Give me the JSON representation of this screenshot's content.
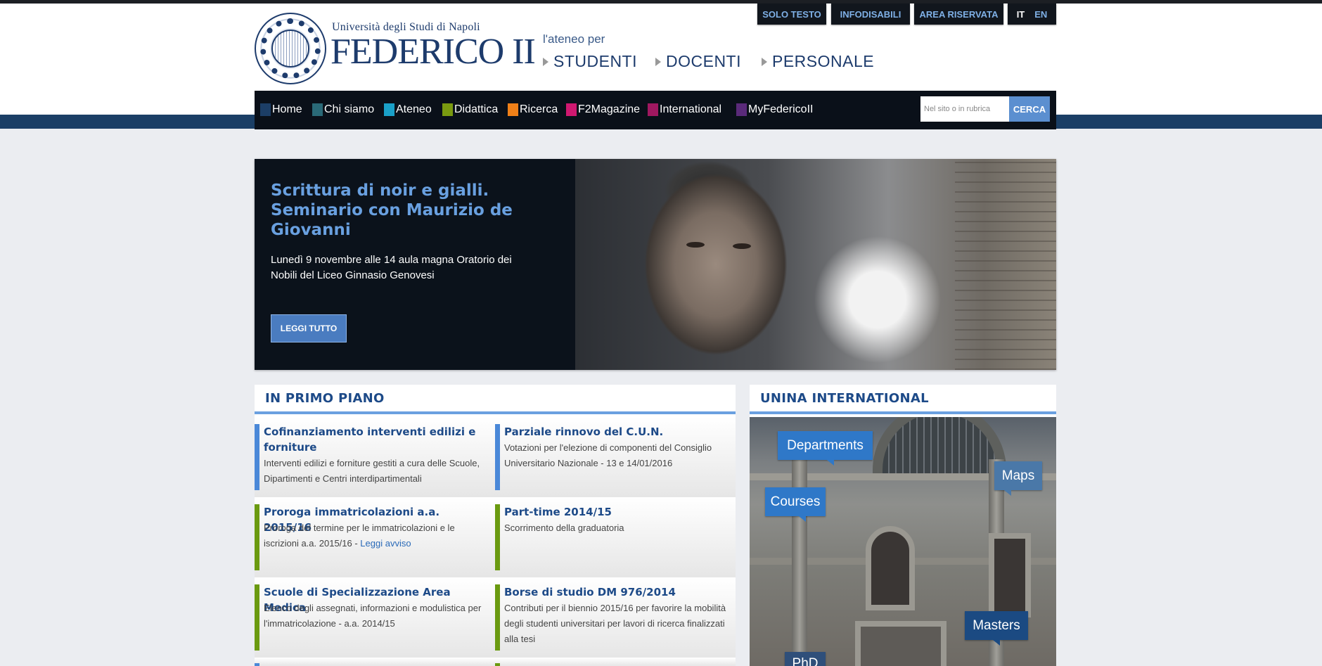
{
  "utility_nav": {
    "solo_testo": "SOLO TESTO",
    "infodisabili": "INFODISABILI",
    "area_riservata": "AREA RISERVATA",
    "lang_it": "IT",
    "lang_en": "EN"
  },
  "logo": {
    "university": "Università degli Studi di Napoli",
    "name": "FEDERICO II"
  },
  "audience": {
    "intro": "l'ateneo per",
    "links": [
      "STUDENTI",
      "DOCENTI",
      "PERSONALE"
    ]
  },
  "main_nav": [
    {
      "label": "Home",
      "color": "#1c3e66"
    },
    {
      "label": "Chi siamo",
      "color": "#2a6a78"
    },
    {
      "label": "Ateneo",
      "color": "#1aa0c8"
    },
    {
      "label": "Didattica",
      "color": "#7a9a10"
    },
    {
      "label": "Ricerca",
      "color": "#f08018"
    },
    {
      "label": "F2Magazine",
      "color": "#d01870"
    },
    {
      "label": "International",
      "color": "#a01860"
    },
    {
      "label": "MyFedericoII",
      "color": "#5a2a7a"
    }
  ],
  "search": {
    "placeholder": "Nel sito o in rubrica",
    "button": "CERCA"
  },
  "hero": {
    "title": "Scrittura di noir e gialli. Seminario con Maurizio de Giovanni",
    "text": "Lunedì 9 novembre alle 14 aula magna Oratorio dei Nobili del Liceo Ginnasio Genovesi",
    "button": "LEGGI TUTTO"
  },
  "primo_piano": {
    "heading": "IN PRIMO PIANO",
    "items": [
      {
        "title": "Cofinanziamento interventi edilizi e forniture",
        "desc": "Interventi edilizi e forniture gestiti a cura delle Scuole, Dipartimenti e Centri interdipartimentali",
        "bar_color": "#4a88d8"
      },
      {
        "title": "Parziale rinnovo del C.U.N.",
        "desc": "Votazioni per l'elezione di componenti del Consiglio Universitario Nazionale - 13 e 14/01/2016",
        "bar_color": "#4a88d8"
      },
      {
        "title": "Proroga immatricolazioni a.a. 2015/16",
        "desc": "Proroga del termine per le immatricolazioni e le iscrizioni  a.a. 2015/16 - ",
        "link": "Leggi avviso",
        "bar_color": "#6a9a10"
      },
      {
        "title": "Part-time 2014/15",
        "desc": "Scorrimento della graduatoria",
        "bar_color": "#6a9a10"
      },
      {
        "title": "Scuole di Specializzazione Area Medica",
        "desc": "Elenco degli assegnati, informazioni e modulistica per l'immatricolazione - a.a. 2014/15",
        "bar_color": "#6a9a10"
      },
      {
        "title": "Borse di studio DM 976/2014",
        "desc": "Contributi per il biennio 2015/16 per favorire la mobilità degli studenti universitari per lavori di ricerca finalizzati alla tesi",
        "bar_color": "#6a9a10"
      }
    ]
  },
  "international": {
    "heading": "UNINA INTERNATIONAL",
    "tags": [
      "Departments",
      "Maps",
      "Courses",
      "Masters",
      "PhD"
    ]
  }
}
